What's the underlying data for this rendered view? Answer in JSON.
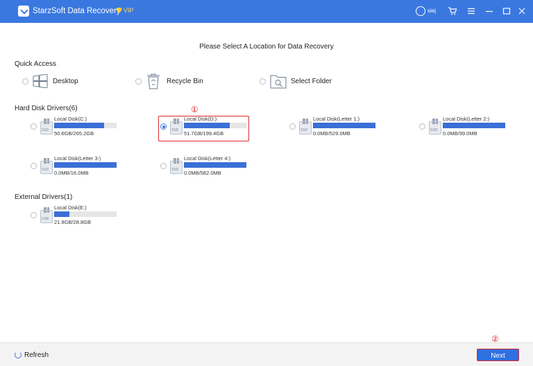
{
  "app": {
    "title": "StarzSoft Data Recovery",
    "vip_label": "VIP",
    "user_name": "siej"
  },
  "heading": "Please Select A Location for Data Recovery",
  "quick_access": {
    "title": "Quick Access",
    "items": [
      {
        "label": "Desktop",
        "icon": "desktop-icon",
        "selected": false
      },
      {
        "label": "Recycle Bin",
        "icon": "recycle-bin-icon",
        "selected": false
      },
      {
        "label": "Select Folder",
        "icon": "folder-search-icon",
        "selected": false
      }
    ]
  },
  "hard_disks": {
    "title": "Hard Disk Drivers(6)",
    "items": [
      {
        "name": "Local Disk(C:)",
        "size": "50.6GB/265.2GB",
        "used_fraction": 0.8,
        "tag": "SSD",
        "selected": false
      },
      {
        "name": "Local Disk(D:)",
        "size": "51.7GB/199.4GB",
        "used_fraction": 0.73,
        "tag": "SSD",
        "selected": true
      },
      {
        "name": "Local Disk(Letter 1:)",
        "size": "0.0MB/529.0MB",
        "used_fraction": 1.0,
        "tag": "SSD",
        "selected": false
      },
      {
        "name": "Local Disk(Letter 2:)",
        "size": "0.0MB/99.0MB",
        "used_fraction": 1.0,
        "tag": "SSD",
        "selected": false
      },
      {
        "name": "Local Disk(Letter 3:)",
        "size": "0.0MB/16.0MB",
        "used_fraction": 1.0,
        "tag": "SSD",
        "selected": false
      },
      {
        "name": "Local Disk(Letter 4:)",
        "size": "0.0MB/582.0MB",
        "used_fraction": 1.0,
        "tag": "SSD",
        "selected": false
      }
    ]
  },
  "external": {
    "title": "External Drivers(1)",
    "items": [
      {
        "name": "Local Disk(E:)",
        "size": "21.9GB/28.8GB",
        "used_fraction": 0.24,
        "tag": "USB",
        "selected": false
      }
    ]
  },
  "annotations": {
    "step1": "①",
    "step2": "②"
  },
  "footer": {
    "refresh_label": "Refresh",
    "next_label": "Next"
  },
  "colors": {
    "accent": "#3a78e0",
    "bar_fill": "#3b6fd6",
    "highlight": "#e0262e"
  }
}
